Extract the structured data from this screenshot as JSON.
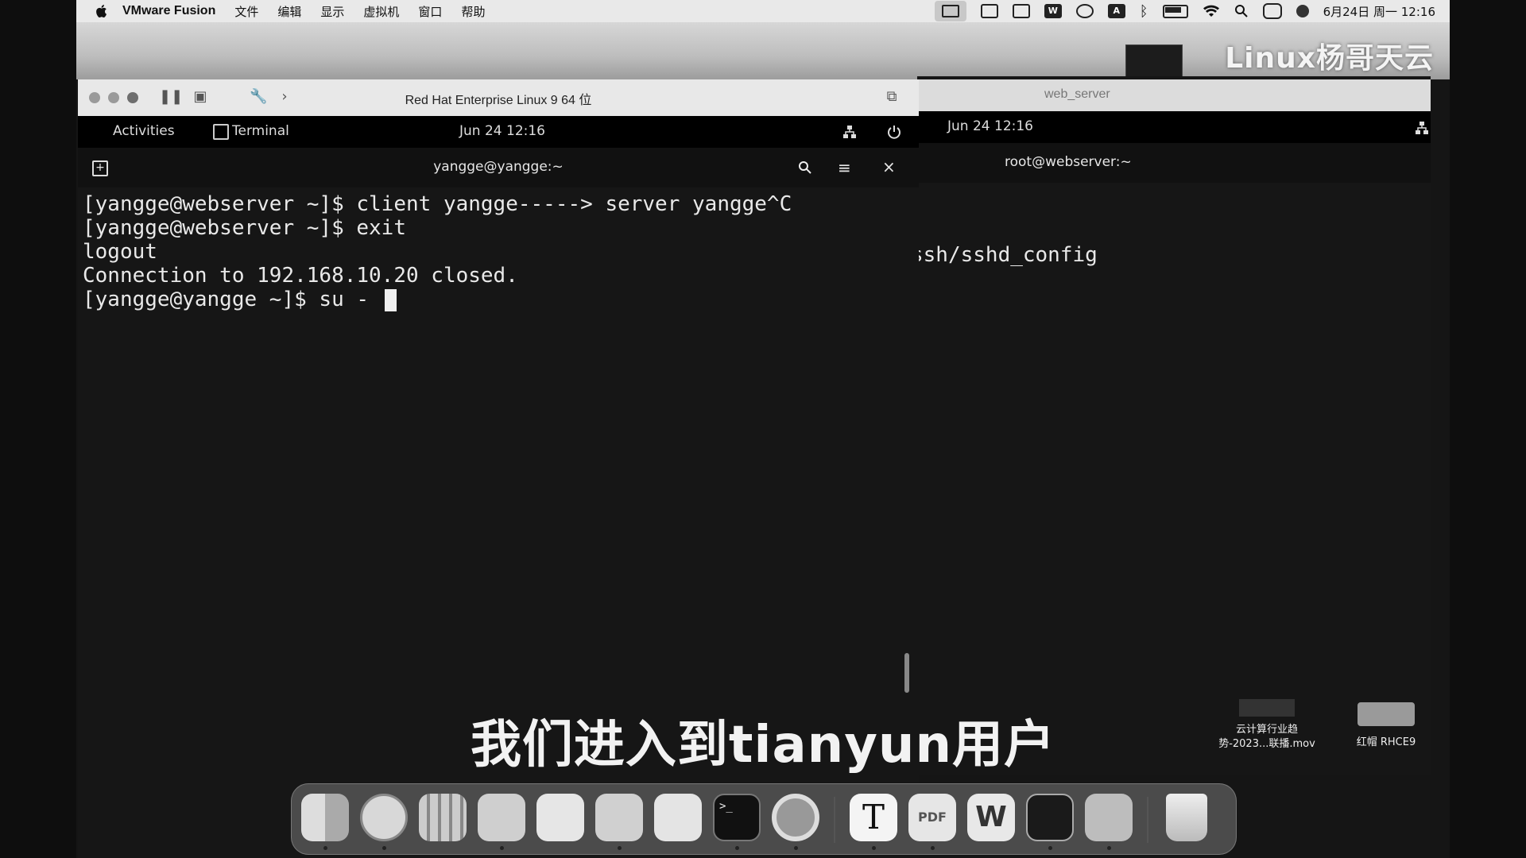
{
  "menubar": {
    "app_name": "VMware Fusion",
    "menus": [
      "文件",
      "编辑",
      "显示",
      "虚拟机",
      "窗口",
      "帮助"
    ],
    "clock": "6月24日 周一  12:16",
    "status_icons": [
      "vmware-status-icon",
      "camera-icon",
      "window-icon",
      "wps-icon",
      "sync-icon",
      "input-a-icon",
      "bluetooth-icon",
      "battery-icon",
      "wifi-icon",
      "search-icon",
      "control-center-icon",
      "siri-icon"
    ]
  },
  "watermark": {
    "text": "Linux杨哥天云"
  },
  "vm1": {
    "title": "Red Hat Enterprise Linux 9 64 位",
    "gnome": {
      "activities": "Activities",
      "terminal": "Terminal",
      "clock": "Jun 24  12:16"
    },
    "terminal_title": "yangge@yangge:~",
    "lines": [
      "[yangge@webserver ~]$ client yangge-----> server yangge^C",
      "[yangge@webserver ~]$ exit",
      "logout",
      "Connection to 192.168.10.20 closed.",
      "[yangge@yangge ~]$ su - "
    ]
  },
  "vm2": {
    "title": "web_server",
    "clock": "Jun 24  12:16",
    "terminal_title": "root@webserver:~",
    "visible_line": "ssh/sshd_config"
  },
  "subtitle": "我们进入到tianyun用户",
  "desktop_files": [
    {
      "label_line1": "云计算行业趋",
      "label_line2": "势-2023...联播.mov"
    },
    {
      "label_line1": "红帽 RHCE9",
      "label_line2": ""
    }
  ],
  "dock": {
    "apps": [
      "finder-icon",
      "safari-icon",
      "launchpad-icon",
      "mail-icon",
      "notes-icon",
      "freeform-icon",
      "folder-icon",
      "terminal-icon",
      "vmware-icon",
      "typora-icon",
      "pdf-expert-icon",
      "wps-icon",
      "chatbot-icon",
      "screen-sharing-icon",
      "trash-icon"
    ]
  },
  "colors": {
    "menubar_bg": "#e9e9e9",
    "terminal_bg": "#161616",
    "terminal_fg": "#e9e9e9"
  }
}
